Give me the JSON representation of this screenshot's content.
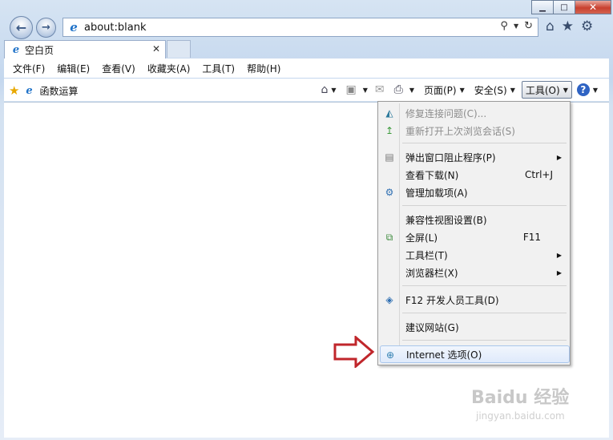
{
  "nav": {
    "url": "about:blank"
  },
  "tab": {
    "title": "空白页",
    "close": "✕"
  },
  "menubar": [
    "文件(F)",
    "编辑(E)",
    "查看(V)",
    "收藏夹(A)",
    "工具(T)",
    "帮助(H)"
  ],
  "favorites": {
    "label": "函数运算"
  },
  "commandbar": {
    "page": "页面(P)",
    "safety": "安全(S)",
    "tools": "工具(O)",
    "help": "?"
  },
  "tools_menu": {
    "items": [
      {
        "label": "修复连接问题(C)...",
        "icon": "repair-icon",
        "disabled": true
      },
      {
        "label": "重新打开上次浏览会话(S)",
        "icon": "reopen-icon",
        "disabled": true
      },
      {
        "label": "弹出窗口阻止程序(P)",
        "icon": "popup-icon",
        "submenu": true
      },
      {
        "label": "查看下载(N)",
        "shortcut": "Ctrl+J"
      },
      {
        "label": "管理加载项(A)",
        "icon": "addons-icon"
      },
      {
        "label": "兼容性视图设置(B)"
      },
      {
        "label": "全屏(L)",
        "icon": "fullscreen-icon",
        "shortcut": "F11"
      },
      {
        "label": "工具栏(T)",
        "submenu": true
      },
      {
        "label": "浏览器栏(X)",
        "submenu": true
      },
      {
        "label": "F12 开发人员工具(D)",
        "icon": "devtools-icon"
      },
      {
        "label": "建议网站(G)"
      },
      {
        "label": "Internet 选项(O)",
        "icon": "internet-options-icon",
        "highlighted": true
      }
    ]
  },
  "watermark": {
    "text": "Baidu 经验",
    "url": "jingyan.baidu.com"
  },
  "colors": {
    "annotation_arrow": "#c0262b",
    "highlight": "#dfeafb"
  }
}
